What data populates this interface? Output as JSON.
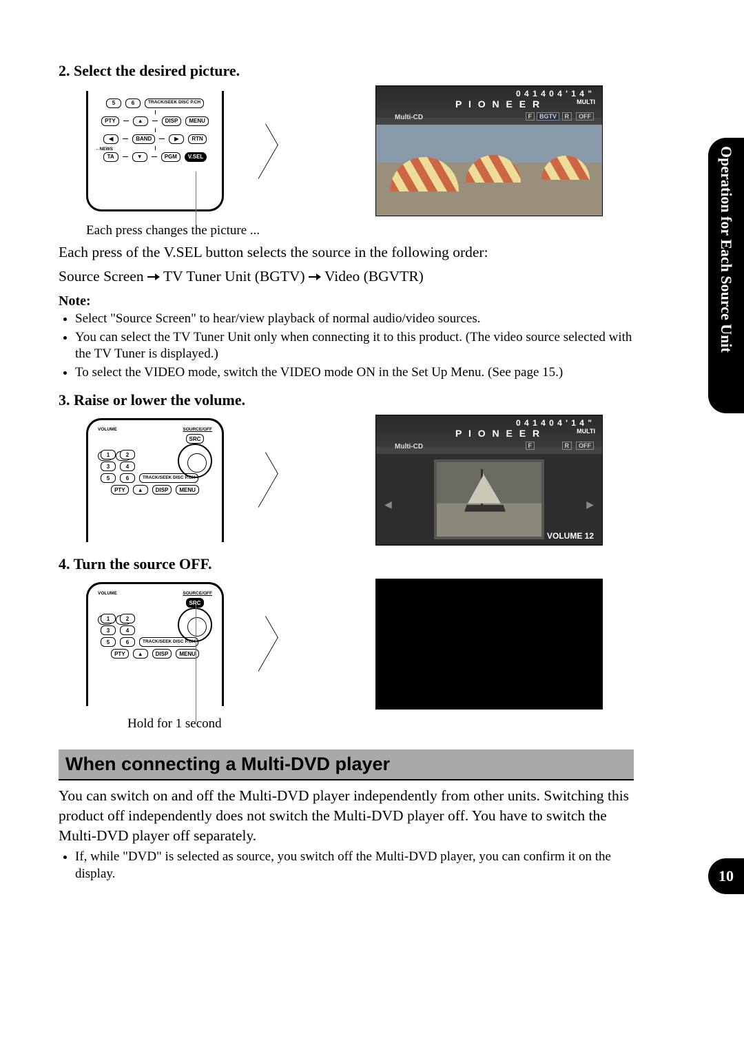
{
  "side_tab": "Operation for Each Source Unit",
  "page_number": "10",
  "step2": {
    "title": "2.  Select the desired picture.",
    "caption": "Each press changes the picture ...",
    "para1": "Each press of the V.SEL button selects the source in the following order:",
    "seq_a": "Source Screen",
    "seq_b": "TV Tuner Unit (BGTV)",
    "seq_c": "Video (BGVTR)",
    "note_label": "Note:",
    "notes": [
      "Select \"Source Screen\" to hear/view playback of normal audio/video sources.",
      "You can select the TV Tuner Unit only when connecting it to this product. (The video source selected with the TV Tuner is displayed.)",
      "To select the VIDEO mode, switch the VIDEO mode ON in the Set Up Menu. (See page 15.)"
    ],
    "screen": {
      "clock": "0 4      1 4      0 4 ' 1 4 \"",
      "brand": "P I O N E E R",
      "mode": "MULTI",
      "src": "Multi-CD",
      "badge1": "F",
      "badge2": "BGTV",
      "badge3": "R",
      "badge4": "OFF"
    },
    "remote_buttons": {
      "r1": [
        "5",
        "6"
      ],
      "r1lbl": "TRACK/SEEK  DISC P.CH",
      "r2": [
        "PTY",
        "▲",
        "DISP",
        "MENU"
      ],
      "r3": [
        "◀",
        "BAND",
        "▶",
        "RTN"
      ],
      "r4lbl": "↔NEWS",
      "r4": [
        "TA",
        "▼",
        "PGM",
        "V.SEL"
      ]
    }
  },
  "step3": {
    "title": "3.  Raise or lower the volume.",
    "screen": {
      "clock": "0 4      1 4      0 4 ' 1 4 \"",
      "brand": "P I O N E E R",
      "mode": "MULTI",
      "src": "Multi-CD",
      "badge1": "F",
      "badge3": "R",
      "badge4": "OFF",
      "volume": "VOLUME    12"
    },
    "remote_labels": {
      "vol": "VOLUME",
      "src_off": "SOURCE/OFF",
      "src": "SRC",
      "ts": "TRACK/SEEK  DISC P.CH"
    },
    "remote_nums": [
      "1",
      "2",
      "3",
      "4",
      "5",
      "6"
    ],
    "remote_bottom": [
      "PTY",
      "▲",
      "DISP",
      "MENU"
    ]
  },
  "step4": {
    "title": "4.  Turn the source OFF.",
    "caption": "Hold for 1 second",
    "remote_labels": {
      "vol": "VOLUME",
      "src_off": "SOURCE/OFF",
      "src": "SRC",
      "ts": "TRACK/SEEK  DISC P.CH"
    },
    "remote_nums": [
      "1",
      "2",
      "3",
      "4",
      "5",
      "6"
    ],
    "remote_bottom": [
      "PTY",
      "▲",
      "DISP",
      "MENU"
    ]
  },
  "section2": {
    "header": "When connecting a Multi-DVD player",
    "para": "You can switch on and off the Multi-DVD player independently from other units. Switching this product off independently does not switch the Multi-DVD player off. You have to switch the Multi-DVD player off separately.",
    "bullet": "If, while \"DVD\" is selected as source, you switch off the Multi-DVD player, you can confirm it on the display."
  }
}
